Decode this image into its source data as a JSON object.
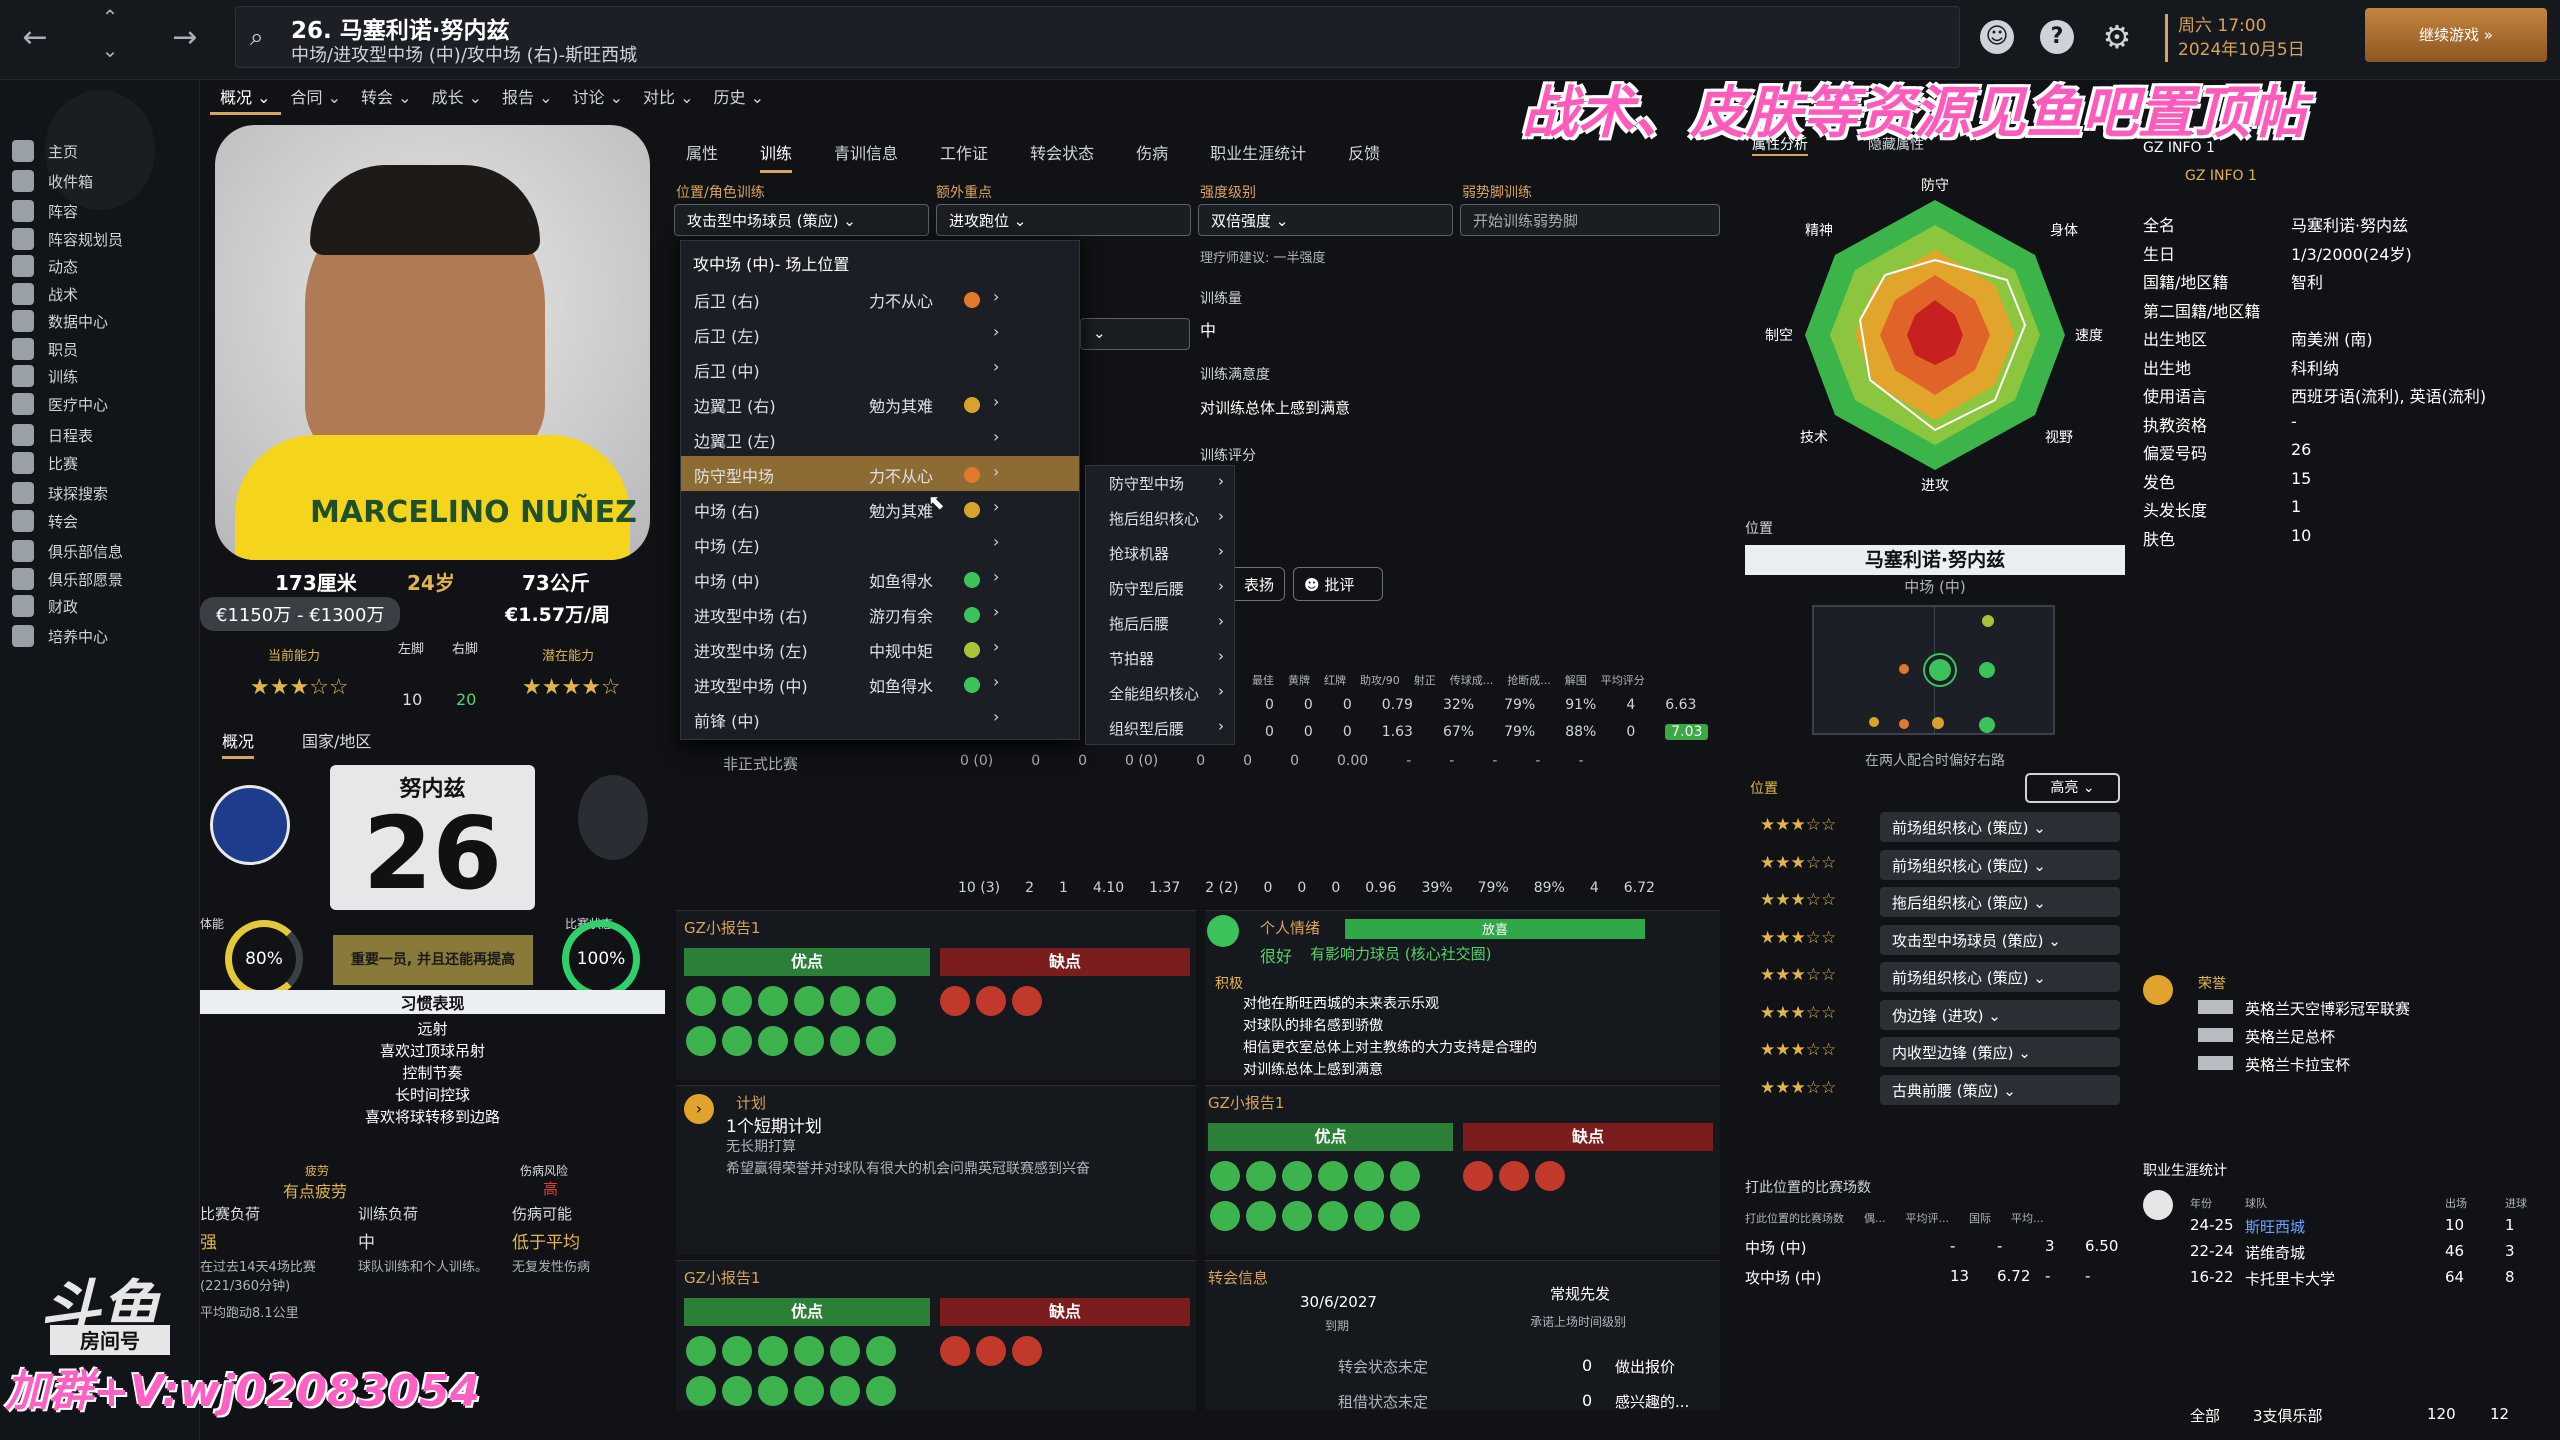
{
  "header": {
    "title": "26. 马塞利诺·努内兹",
    "subtitle": "中场/进攻型中场 (中)/攻中场 (右)-斯旺西城",
    "date_line1": "周六 17:00",
    "date_line2": "2024年10月5日",
    "continue": "继续游戏"
  },
  "sidebar": {
    "items": [
      "主页",
      "收件箱",
      "阵容",
      "阵容规划员",
      "动态",
      "战术",
      "数据中心",
      "职员",
      "训练",
      "医疗中心",
      "日程表",
      "比赛",
      "球探搜索",
      "转会",
      "俱乐部信息",
      "俱乐部愿景",
      "财政",
      "培养中心"
    ]
  },
  "menu": [
    "概况",
    "合同",
    "转会",
    "成长",
    "报告",
    "讨论",
    "对比",
    "历史"
  ],
  "profile": {
    "height": "173厘米",
    "age": "24岁",
    "weight": "73公斤",
    "value": "€1150万 - €1300万",
    "wage": "€1.57万/周",
    "ca_label": "当前能力",
    "pa_label": "潜在能力",
    "left_label": "左脚",
    "right_label": "右脚",
    "left_val": "10",
    "right_val": "20",
    "ca_stars": "★★★☆☆",
    "pa_stars": "★★★★☆",
    "photo_name": "MARCELINO NUÑEZ"
  },
  "nat": {
    "tab1": "概况",
    "tab2": "国家/地区",
    "name": "努内兹",
    "number": "26",
    "fitness_label": "体能",
    "fitness": "80%",
    "morale_label": "比赛状态",
    "morale": "100%",
    "note": "重要一员, 并且还能再提高"
  },
  "traits": {
    "title": "习惯表现",
    "items": [
      "远射",
      "喜欢过顶球吊射",
      "控制节奏",
      "长时间控球",
      "喜欢将球转移到边路"
    ]
  },
  "risk": {
    "tired_label": "疲劳",
    "tired": "有点疲劳",
    "injury_label": "伤病风险",
    "injury": "高",
    "match_load_label": "比赛负荷",
    "match_load": "强",
    "training_load_label": "训练负荷",
    "training_load": "中",
    "injury_pos_label": "伤病可能",
    "injury_pos": "低于平均",
    "match_note": "在过去14天4场比赛 (221/360分钟)",
    "match_note2": "平均跑动8.1公里",
    "training_note": "球队训练和个人训练。",
    "injury_note": "无复发性伤病"
  },
  "subtabs": [
    "属性",
    "训练",
    "青训信息",
    "工作证",
    "转会状态",
    "伤病",
    "职业生涯统计",
    "反馈"
  ],
  "training": {
    "role_label": "位置/角色训练",
    "role_value": "攻击型中场球员 (策应)",
    "extra_label": "额外重点",
    "extra_value": "进攻跑位",
    "intensity_label": "强度级别",
    "intensity_value": "双倍强度",
    "weak_label": "弱势脚训练",
    "weak_value": "开始训练弱势脚",
    "intensity_note": "理疗师建议: 一半强度",
    "load_label": "训练量",
    "load_value": "中",
    "happy_label": "训练满意度",
    "happy_value": "对训练总体上感到满意",
    "rating_label": "训练评分",
    "criticize": "批评",
    "praise": "表扬"
  },
  "dropdown": {
    "header": "攻中场 (中)- 场上位置",
    "items": [
      {
        "name": "后卫 (右)",
        "ability": "力不从心",
        "dot": "#e07a2a"
      },
      {
        "name": "后卫 (左)",
        "ability": "",
        "dot": ""
      },
      {
        "name": "后卫 (中)",
        "ability": "",
        "dot": ""
      },
      {
        "name": "边翼卫 (右)",
        "ability": "勉为其难",
        "dot": "#d8a32a"
      },
      {
        "name": "边翼卫 (左)",
        "ability": "",
        "dot": ""
      },
      {
        "name": "防守型中场",
        "ability": "力不从心",
        "dot": "#e07a2a"
      },
      {
        "name": "中场 (右)",
        "ability": "勉为其难",
        "dot": "#d8a32a"
      },
      {
        "name": "中场 (左)",
        "ability": "",
        "dot": ""
      },
      {
        "name": "中场 (中)",
        "ability": "如鱼得水",
        "dot": "#3cc25a"
      },
      {
        "name": "进攻型中场 (右)",
        "ability": "游刃有余",
        "dot": "#3cc25a"
      },
      {
        "name": "进攻型中场 (左)",
        "ability": "中规中矩",
        "dot": "#a8c23a"
      },
      {
        "name": "进攻型中场 (中)",
        "ability": "如鱼得水",
        "dot": "#3cc25a"
      },
      {
        "name": "前锋 (中)",
        "ability": "",
        "dot": ""
      }
    ]
  },
  "submenu": [
    "防守型中场",
    "拖后组织核心",
    "抢球机器",
    "防守型后腰",
    "拖后后腰",
    "节拍器",
    "全能组织核心",
    "组织型后腰"
  ],
  "stats": {
    "headers": [
      "最佳",
      "黄牌",
      "红牌",
      "助攻/90",
      "射正",
      "传球成...",
      "抢断成...",
      "解围",
      "平均评分"
    ],
    "rows": [
      [
        "0",
        "0",
        "0",
        "0.79",
        "32%",
        "79%",
        "91%",
        "4",
        "6.63"
      ],
      [
        "0",
        "0",
        "0",
        "1.63",
        "67%",
        "79%",
        "88%",
        "0",
        "7.03"
      ]
    ],
    "friendly_label": "非正式比赛",
    "friendly": [
      "0 (0)",
      "0",
      "0",
      "0 (0)",
      "0",
      "0",
      "0",
      "0.00",
      "-",
      "-",
      "-",
      "-",
      "-"
    ],
    "total": [
      "10 (3)",
      "2",
      "1",
      "4.10",
      "1.37",
      "2 (2)",
      "0",
      "0",
      "0",
      "0.96",
      "39%",
      "79%",
      "89%",
      "4",
      "6.72"
    ]
  },
  "report1": {
    "title": "GZ小报告1",
    "pros": "优点",
    "cons": "缺点"
  },
  "personal": {
    "title": "个人情绪",
    "bar": "放喜",
    "mood": "很好",
    "influence": "有影响力球员 (核心社交圈)",
    "pos_label": "积极",
    "items": [
      "对他在斯旺西城的未来表示乐观",
      "对球队的排名感到骄傲",
      "相信更衣室总体上对主教练的大力支持是合理的",
      "对训练总体上感到满意"
    ]
  },
  "plan": {
    "title": "计划",
    "value": "1个短期计划",
    "sub": "无长期打算",
    "desc": "希望赢得荣誉并对球队有很大的机会问鼎英冠联赛感到兴奋"
  },
  "report2": {
    "title": "GZ小报告1",
    "pros": "优点",
    "cons": "缺点"
  },
  "report3": {
    "title": "GZ小报告1",
    "pros": "优点",
    "cons": "缺点"
  },
  "transfer": {
    "title": "转会信息",
    "date": "30/6/2027",
    "date_label": "到期",
    "regular": "常规先发",
    "regular_sub": "承诺上场时间级别",
    "status1": "转会状态未定",
    "status2": "租借状态未定",
    "offers": "0",
    "offers_label": "做出报价",
    "interest": "0",
    "interest_label": "感兴趣的..."
  },
  "attr": {
    "tab1": "属性分析",
    "tab2": "隐藏属性",
    "labels": [
      "防守",
      "身体",
      "速度",
      "视野",
      "进攻",
      "技术",
      "制空",
      "精神"
    ]
  },
  "position": {
    "title": "位置",
    "name": "马塞利诺·努内兹",
    "pos": "中场 (中)",
    "note": "在两人配合时偏好右路",
    "pos_label": "位置",
    "highlight": "高亮",
    "roles": [
      {
        "stars": "★★★☆☆",
        "role": "前场组织核心 (策应)"
      },
      {
        "stars": "★★★☆☆",
        "role": "前场组织核心 (策应)"
      },
      {
        "stars": "★★★☆☆",
        "role": "拖后组织核心 (策应)"
      },
      {
        "stars": "★★★☆☆",
        "role": "攻击型中场球员 (策应)"
      },
      {
        "stars": "★★★☆☆",
        "role": "前场组织核心 (策应)"
      },
      {
        "stars": "★★★☆☆",
        "role": "伪边锋 (进攻)"
      },
      {
        "stars": "★★★☆☆",
        "role": "内收型边锋 (策应)"
      },
      {
        "stars": "★★★☆☆",
        "role": "古典前腰 (策应)"
      }
    ]
  },
  "posmatches": {
    "title": "打此位置的比赛场数",
    "headers": [
      "打此位置的比赛场数",
      "偶...",
      "平均评...",
      "国际",
      "平均..."
    ],
    "rows": [
      [
        "中场 (中)",
        "-",
        "-",
        "3",
        "6.50"
      ],
      [
        "攻中场 (中)",
        "13",
        "6.72",
        "-",
        "-"
      ]
    ]
  },
  "gzinfo": {
    "title": "GZ INFO 1",
    "sub": "GZ INFO 1",
    "rows": [
      [
        "全名",
        "马塞利诺·努内兹"
      ],
      [
        "生日",
        "1/3/2000(24岁)"
      ],
      [
        "国籍/地区籍",
        "智利"
      ],
      [
        "第二国籍/地区籍",
        ""
      ],
      [
        "出生地区",
        "南美洲 (南)"
      ],
      [
        "出生地",
        "科利纳"
      ],
      [
        "使用语言",
        "西班牙语(流利), 英语(流利)"
      ],
      [
        "执教资格",
        "-"
      ],
      [
        "偏爱号码",
        "26"
      ],
      [
        "发色",
        "15"
      ],
      [
        "头发长度",
        "1"
      ],
      [
        "肤色",
        "10"
      ]
    ]
  },
  "honors": {
    "title": "荣誉",
    "items": [
      "英格兰天空博彩冠军联赛",
      "英格兰足总杯",
      "英格兰卡拉宝杯"
    ]
  },
  "career": {
    "title": "职业生涯统计",
    "headers": [
      "年份",
      "球队",
      "出场",
      "进球"
    ],
    "rows": [
      [
        "24-25",
        "斯旺西城",
        "10",
        "1"
      ],
      [
        "22-24",
        "诺维奇城",
        "46",
        "3"
      ],
      [
        "16-22",
        "卡托里卡大学",
        "64",
        "8"
      ]
    ],
    "total_label": "全部",
    "total_clubs": "3支俱乐部",
    "total_apps": "120",
    "total_goals": "12"
  },
  "overlay": {
    "banner": "战术、皮肤等资源见鱼吧置顶帖",
    "watermark": "加群+V:wj02083054",
    "logo": "斗鱼",
    "logo2": "房间号"
  },
  "colors": {
    "accent": "#d8a35a",
    "green": "#3cc25a",
    "red": "#c0392b"
  }
}
